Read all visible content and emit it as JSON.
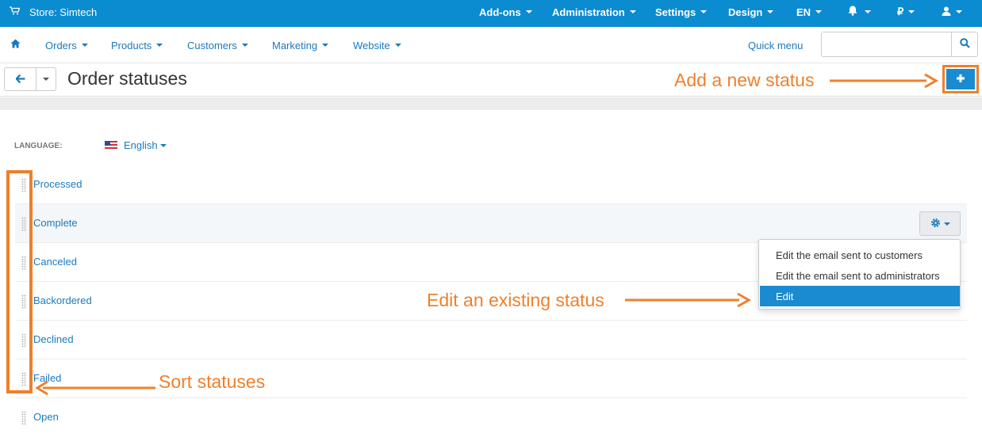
{
  "topbar": {
    "store": "Store: Simtech",
    "menus": [
      {
        "label": "Add-ons"
      },
      {
        "label": "Administration"
      },
      {
        "label": "Settings"
      },
      {
        "label": "Design"
      },
      {
        "label": "EN"
      },
      {
        "label": "₽"
      }
    ]
  },
  "nav": {
    "items": [
      {
        "label": "Orders"
      },
      {
        "label": "Products"
      },
      {
        "label": "Customers"
      },
      {
        "label": "Marketing"
      },
      {
        "label": "Website"
      }
    ],
    "quick_menu": "Quick menu",
    "search_value": ""
  },
  "page": {
    "title": "Order statuses"
  },
  "language": {
    "label": "LANGUAGE:",
    "value": "English"
  },
  "statuses": [
    {
      "name": "Processed"
    },
    {
      "name": "Complete"
    },
    {
      "name": "Canceled"
    },
    {
      "name": "Backordered"
    },
    {
      "name": "Declined"
    },
    {
      "name": "Failed"
    },
    {
      "name": "Open"
    }
  ],
  "dropdown": {
    "items": [
      {
        "label": "Edit the email sent to customers"
      },
      {
        "label": "Edit the email sent to administrators"
      },
      {
        "label": "Edit"
      }
    ]
  },
  "annotations": {
    "add": "Add a new status",
    "edit": "Edit an existing status",
    "sort": "Sort statuses"
  },
  "colors": {
    "brand": "#0b8bd0",
    "link": "#1a7abd",
    "annotation": "#f07f2a"
  }
}
